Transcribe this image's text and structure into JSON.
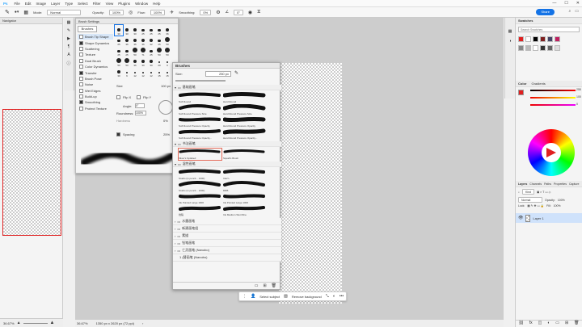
{
  "menubar": {
    "app": "Ps",
    "items": [
      "File",
      "Edit",
      "Image",
      "Layer",
      "Type",
      "Select",
      "Filter",
      "View",
      "Plugins",
      "Window",
      "Help"
    ],
    "window_controls": [
      "—",
      "☐",
      "✕"
    ]
  },
  "options": {
    "mode_label": "Mode:",
    "mode_value": "Normal",
    "opacity_label": "Opacity:",
    "opacity_value": "100%",
    "flow_label": "Flow:",
    "flow_value": "100%",
    "smoothing_label": "Smoothing:",
    "smoothing_value": "0%",
    "angle_value": "0°",
    "share_label": "Share"
  },
  "navigator": {
    "tab_label": "Navigator",
    "zoom_value": "36.67%"
  },
  "status": {
    "zoom": "36.67%",
    "doc_info": "1350 px x 2620 px (72 ppi)"
  },
  "brush_settings": {
    "title": "Brush Settings",
    "brushes_button": "Brushes",
    "items": [
      {
        "label": "Brush Tip Shape",
        "checked": false,
        "selected": true
      },
      {
        "label": "Shape Dynamics",
        "checked": true,
        "selected": false
      },
      {
        "label": "Scattering",
        "checked": false,
        "selected": false
      },
      {
        "label": "Texture",
        "checked": false,
        "selected": false
      },
      {
        "label": "Dual Brush",
        "checked": false,
        "selected": false
      },
      {
        "label": "Color Dynamics",
        "checked": false,
        "selected": false
      },
      {
        "label": "Transfer",
        "checked": true,
        "selected": false
      },
      {
        "label": "Brush Pose",
        "checked": false,
        "selected": false
      },
      {
        "label": "Noise",
        "checked": false,
        "selected": false
      },
      {
        "label": "Wet Edges",
        "checked": false,
        "selected": false
      },
      {
        "label": "Build-up",
        "checked": false,
        "selected": false
      },
      {
        "label": "Smoothing",
        "checked": true,
        "selected": false
      },
      {
        "label": "Protect Texture",
        "checked": false,
        "selected": false
      }
    ],
    "tips": [
      "30",
      "30",
      "30",
      "25",
      "25",
      "25",
      "36",
      "25",
      "36",
      "36",
      "36",
      "32",
      "25",
      "50",
      "25",
      "25",
      "50",
      "71",
      "25",
      "50",
      "50",
      "50",
      "50",
      "36",
      "30",
      "30",
      "20",
      "9",
      "30",
      "9",
      "12",
      "12",
      "12",
      "15",
      "15"
    ],
    "size_label": "Size",
    "size_value": "100 px",
    "flip_x": "Flip X",
    "flip_y": "Flip Y",
    "angle_label": "Angle:",
    "angle_value": "0°",
    "roundness_label": "Roundness:",
    "roundness_value": "100%",
    "hardness_label": "Hardness",
    "hardness_value": "0%",
    "spacing_label": "Spacing",
    "spacing_value": "25%"
  },
  "brushes": {
    "title": "Brushes",
    "size_label": "Size:",
    "size_value": "250 px",
    "groups": [
      {
        "name": "基础画笔",
        "brushes": [
          "Soft Round",
          "Hard Round",
          "Soft Round Pressure Size",
          "Hard Round Pressure Size",
          "Soft Round Pressure Opacity",
          "Hard Round Pressure Opacity",
          "Soft Round Pressure Opacity...",
          "Hard Round Pressure Opacity..."
        ]
      },
      {
        "name": "书法画笔",
        "brushes": [
          "Mixer's Splatted",
          "Squall's Brush"
        ]
      },
      {
        "name": "湿性画笔",
        "brushes": [
          "Studio (in pencil... 1000)",
          "Ink2 L",
          "Studio (in pencil... 1000)",
          "DRB",
          "Ink Pointed Large 1000",
          "Ink Pointed Large 1000",
          "线稿",
          "Ink Medium Wet Mine"
        ]
      }
    ],
    "closed_groups": [
      "水墨画笔",
      "新建画笔组",
      "素描",
      "铅笔画笔",
      "亡灵画笔 (Nanobo)"
    ],
    "sub_item": "1 (替画笔 (Nanobo)"
  },
  "context_bar": {
    "select_subject": "Select subject",
    "remove_background": "Remove background"
  },
  "swatches": {
    "title": "Swatches",
    "search_placeholder": "Search Swatches",
    "colors": [
      "#e02020",
      "#ffffff",
      "#000000",
      "#7f2020",
      "#444466",
      "#c02060",
      "#888888",
      "#bbbbbb",
      "#ffffff",
      "#333333",
      "#666666",
      "#dddddd"
    ]
  },
  "color_panel": {
    "tabs": [
      "Color",
      "Gradients"
    ],
    "r": "255",
    "g": "100",
    "b": "0"
  },
  "layers": {
    "tabs": [
      "Layers",
      "Channels",
      "Paths",
      "Properties",
      "Capture"
    ],
    "kind_label": "Kind",
    "blend_mode": "Normal",
    "opacity_label": "Opacity:",
    "opacity_value": "100%",
    "lock_label": "Lock:",
    "fill_label": "Fill:",
    "fill_value": "100%",
    "layer_name": "Layer 1"
  },
  "colors": {
    "accent": "#1473e6",
    "selection": "#e02020"
  }
}
